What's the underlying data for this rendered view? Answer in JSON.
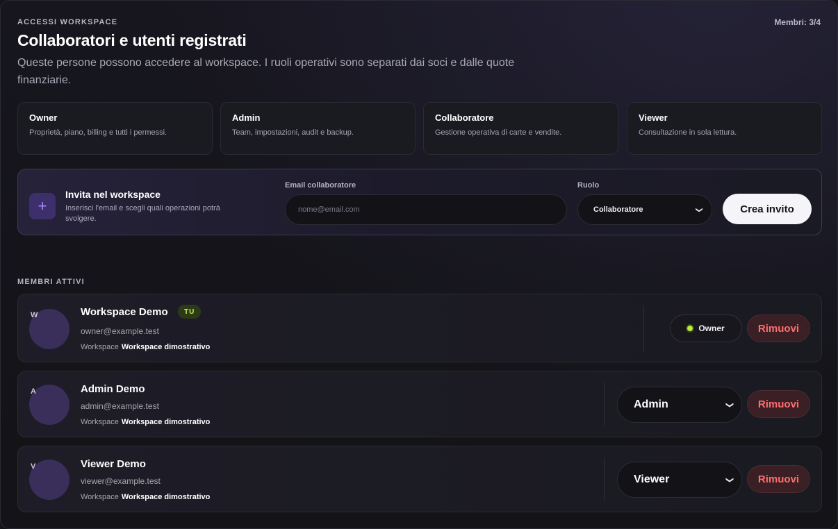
{
  "header": {
    "eyebrow": "ACCESSI WORKSPACE",
    "member_count": "Membri: 3/4",
    "title": "Collaboratori e utenti registrati",
    "subtitle": "Queste persone possono accedere al workspace. I ruoli operativi sono separati dai soci e dalle quote finanziarie."
  },
  "roles": [
    {
      "name": "Owner",
      "description": "Proprietà, piano, billing e tutti i permessi."
    },
    {
      "name": "Admin",
      "description": "Team, impostazioni, audit e backup."
    },
    {
      "name": "Collaboratore",
      "description": "Gestione operativa di carte e vendite."
    },
    {
      "name": "Viewer",
      "description": "Consultazione in sola lettura."
    }
  ],
  "invite": {
    "icon": "plus-icon",
    "icon_glyph": "+",
    "title": "Invita nel workspace",
    "description": "Inserisci l'email e scegli quali operazioni potrà svolgere.",
    "email_label": "Email collaboratore",
    "email_placeholder": "nome@email.com",
    "role_label": "Ruolo",
    "role_value": "Collaboratore",
    "submit_label": "Crea invito"
  },
  "members_section_label": "MEMBRI ATTIVI",
  "members": [
    {
      "initial": "W",
      "name": "Workspace Demo",
      "badge": "TU",
      "email": "owner@example.test",
      "workspace_label": "Workspace",
      "workspace_name": "Workspace dimostrativo",
      "role": "Owner",
      "remove_label": "Rimuovi"
    },
    {
      "initial": "A",
      "name": "Admin Demo",
      "email": "admin@example.test",
      "workspace_label": "Workspace",
      "workspace_name": "Workspace dimostrativo",
      "role": "Admin",
      "remove_label": "Rimuovi"
    },
    {
      "initial": "V",
      "name": "Viewer Demo",
      "email": "viewer@example.test",
      "workspace_label": "Workspace",
      "workspace_name": "Workspace dimostrativo",
      "role": "Viewer",
      "remove_label": "Rimuovi"
    }
  ],
  "colors": {
    "background": "#141419",
    "accent_purple": "#3c2f6b",
    "owner_dot": "#b8ef3a",
    "badge_text": "#c6ef4c",
    "danger": "#ff6e6e"
  }
}
